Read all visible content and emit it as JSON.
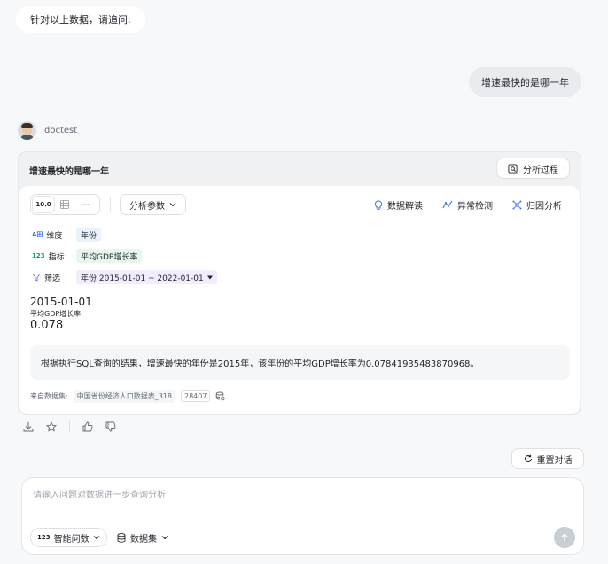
{
  "chat": {
    "prompt_bubble": "针对以上数据，请追问:",
    "user_question": "增速最快的是哪一年"
  },
  "agent": {
    "name": "doctest"
  },
  "answer_card": {
    "title": "增速最快的是哪一年",
    "analysis_button": "分析过程",
    "view_toggle": {
      "numeric_icon_text": "10.0",
      "more": "···"
    },
    "params_button": "分析参数",
    "tools": {
      "data_interpret": "数据解读",
      "anomaly_detect": "异常检测",
      "attribution": "归因分析"
    },
    "meta": {
      "dimension": {
        "icon_text": "A田",
        "label": "维度",
        "value": "年份"
      },
      "metric": {
        "icon_text": "123",
        "label": "指标",
        "value": "平均GDP增长率"
      },
      "filter": {
        "label": "筛选",
        "value": "年份 2015-01-01 ~ 2022-01-01"
      }
    },
    "result": {
      "date": "2015-01-01",
      "metric_label": "平均GDP增长率",
      "value": "0.078"
    },
    "summary": "根据执行SQL查询的结果，增速最快的年份是2015年，该年份的平均GDP增长率为0.07841935483870968。",
    "source": {
      "label": "来自数据集:",
      "dataset_name": "中国省份经济人口数据表_318",
      "count": "28407"
    }
  },
  "reset_button": "重置对话",
  "composer": {
    "placeholder": "请输入问题对数据进一步查询分析",
    "mode_icon_text": "123",
    "mode_label": "智能问数",
    "dataset_label": "数据集"
  },
  "colors": {
    "dimension_tag_bg": "#e8f3ff",
    "dimension_icon": "#3370ff",
    "metric_tag_bg": "#e8f7ee",
    "metric_icon": "#00a85a",
    "filter_tag_bg": "#f3ecff",
    "filter_icon": "#7b61ff",
    "send_button_disabled": "#c9cdd4"
  }
}
